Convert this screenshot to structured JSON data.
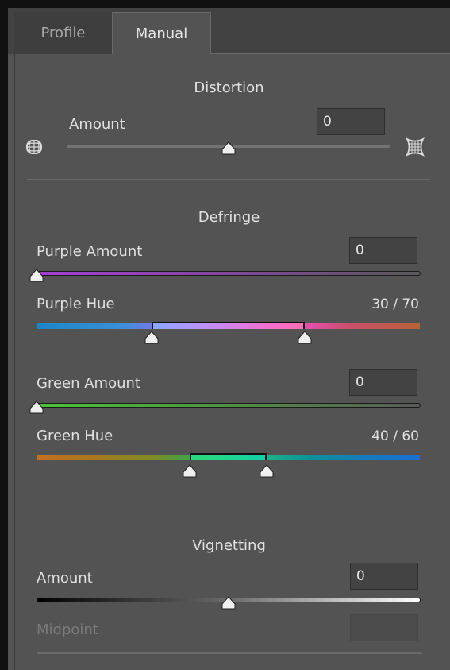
{
  "tabs": [
    {
      "label": "Profile",
      "active": false
    },
    {
      "label": "Manual",
      "active": true
    }
  ],
  "distortion": {
    "heading": "Distortion",
    "amount_label": "Amount",
    "amount_value": "0",
    "slider_fraction": 0.5,
    "icon_left": "barrel-distortion-icon",
    "icon_right": "pincushion-distortion-icon"
  },
  "defringe": {
    "heading": "Defringe",
    "purple_amount_label": "Purple Amount",
    "purple_amount_value": "0",
    "purple_amount_fraction": 0.0,
    "purple_hue_label": "Purple Hue",
    "purple_hue_value": "30 / 70",
    "purple_hue_range": [
      0.3,
      0.7
    ],
    "green_amount_label": "Green Amount",
    "green_amount_value": "0",
    "green_amount_fraction": 0.0,
    "green_hue_label": "Green Hue",
    "green_hue_value": "40 / 60",
    "green_hue_range": [
      0.4,
      0.6
    ]
  },
  "vignetting": {
    "heading": "Vignetting",
    "amount_label": "Amount",
    "amount_value": "0",
    "slider_fraction": 0.5,
    "midpoint_label": "Midpoint",
    "midpoint_value": ""
  },
  "colors": {
    "panel": "#535353",
    "tabbar": "#424242",
    "purple": "#a43fd6",
    "green": "#4cc33a",
    "hue_purple_selected": "#c68cf0",
    "hue_green_selected": "#1fd58c"
  }
}
